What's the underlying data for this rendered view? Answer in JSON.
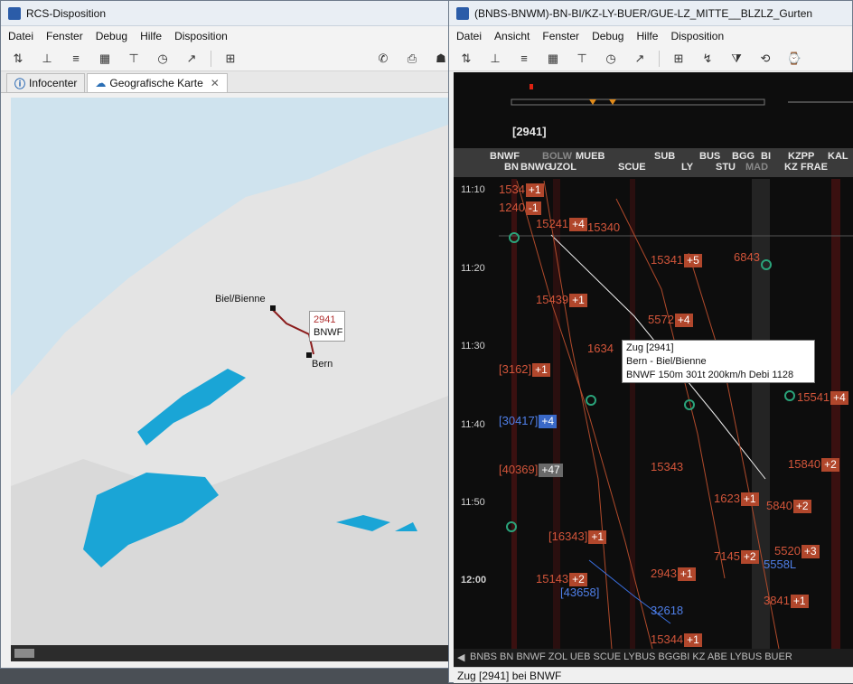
{
  "left_window": {
    "title": "RCS-Disposition",
    "menu": [
      "Datei",
      "Fenster",
      "Debug",
      "Hilfe",
      "Disposition"
    ],
    "tabs": [
      {
        "label": "Infocenter",
        "icon": "info-icon"
      },
      {
        "label": "Geografische Karte",
        "icon": "map-icon",
        "close_icon": "close-icon"
      }
    ],
    "map": {
      "places": [
        {
          "name": "Biel/Bienne"
        },
        {
          "name": "Bern"
        }
      ],
      "callout": {
        "number": "2941",
        "code": "BNWF"
      }
    }
  },
  "right_window": {
    "title": "(BNBS-BNWM)-BN-BI/KZ-LY-BUER/GUE-LZ_MITTE__BLZLZ_Gurten",
    "menu": [
      "Datei",
      "Ansicht",
      "Fenster",
      "Debug",
      "Hilfe",
      "Disposition"
    ],
    "train_id": "[2941]",
    "stations_top": [
      "BNWF",
      "BOLW",
      "MUEB",
      "SUB",
      "BUS",
      "BGG",
      "BI",
      "KZPP",
      "KAL"
    ],
    "stations_bottom": [
      "BN",
      "BNWG",
      "UZOL",
      "SCUE",
      "LY",
      "STU",
      "MAD",
      "KZ",
      "FRAE"
    ],
    "times": [
      "11:10",
      "11:20",
      "11:30",
      "11:40",
      "11:50",
      "12:00"
    ],
    "trains": [
      {
        "label": "1534",
        "delay": "+1"
      },
      {
        "label": "1240",
        "delay": "-1"
      },
      {
        "label": "15241",
        "delay": "+4"
      },
      {
        "label": "15340",
        "delay": ""
      },
      {
        "label": "15341",
        "delay": "+5"
      },
      {
        "label": "6843",
        "delay": ""
      },
      {
        "label": "15439",
        "delay": "+1"
      },
      {
        "label": "5572",
        "delay": "+4"
      },
      {
        "label": "1634",
        "delay": ""
      },
      {
        "label": "[3162]",
        "delay": "+1"
      },
      {
        "label": "[30417]",
        "delay": "+4"
      },
      {
        "label": "[40369]",
        "delay": "+47"
      },
      {
        "label": "15541",
        "delay": "+4"
      },
      {
        "label": "15343",
        "delay": ""
      },
      {
        "label": "15840",
        "delay": "+2"
      },
      {
        "label": "1623",
        "delay": "+1"
      },
      {
        "label": "5840",
        "delay": "+2"
      },
      {
        "label": "[16343]",
        "delay": "+1"
      },
      {
        "label": "5520",
        "delay": "+3"
      },
      {
        "label": "7145",
        "delay": "+2"
      },
      {
        "label": "5558L",
        "delay": ""
      },
      {
        "label": "2943",
        "delay": "+1"
      },
      {
        "label": "15143",
        "delay": "+2"
      },
      {
        "label": "[43658]",
        "delay": ""
      },
      {
        "label": "32618",
        "delay": ""
      },
      {
        "label": "3841",
        "delay": "+1"
      },
      {
        "label": "15344",
        "delay": "+1"
      }
    ],
    "tooltip": {
      "line1": "Zug [2941]",
      "line2": "Bern - Biel/Bienne",
      "line3": "BNWF  150m  301t  200km/h  Debi 1128"
    },
    "bottom_stations": "BNBS BN BNWF ZOL UEB SCUE  LYBUS BGGBI KZ   ABE  LYBUS BUER",
    "status": "Zug [2941] bei BNWF"
  }
}
